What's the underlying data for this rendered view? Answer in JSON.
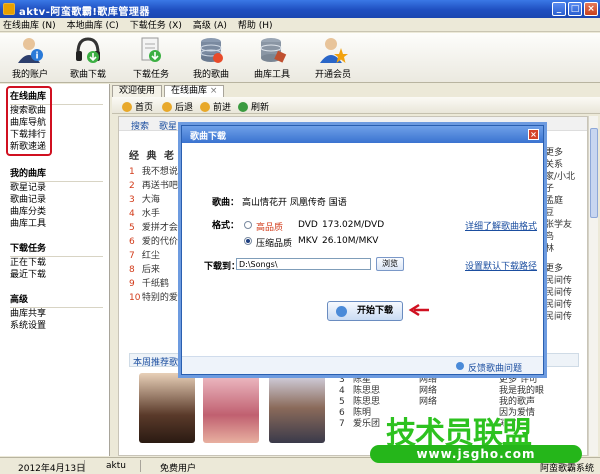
{
  "window": {
    "title": "aktv-阿蛮歌霸!歌库管理器"
  },
  "menu": [
    "在线曲库 (N)",
    "本地曲库 (C)",
    "下载任务 (X)",
    "高级 (A)",
    "帮助 (H)"
  ],
  "toolbar": [
    {
      "label": "我的账户",
      "icon": "user-info-icon"
    },
    {
      "label": "歌曲下载",
      "icon": "headphones-icon"
    },
    {
      "label": "下载任务",
      "icon": "download-task-icon"
    },
    {
      "label": "我的歌曲",
      "icon": "database-icon"
    },
    {
      "label": "曲库工具",
      "icon": "tools-database-icon"
    },
    {
      "label": "开通会员",
      "icon": "member-star-icon"
    }
  ],
  "sidebar": [
    {
      "title": "在线曲库",
      "items": [
        "搜索歌曲",
        "曲库导航",
        "下载排行",
        "新歌速递"
      ]
    },
    {
      "title": "我的曲库",
      "items": [
        "歌星记录",
        "歌曲记录",
        "曲库分类",
        "曲库工具"
      ]
    },
    {
      "title": "下载任务",
      "items": [
        "正在下载",
        "最近下载"
      ]
    },
    {
      "title": "高级",
      "items": [
        "曲库共享",
        "系统设置"
      ]
    }
  ],
  "tabs": [
    "欢迎使用",
    "在线曲库"
  ],
  "nav": [
    "首页",
    "后退",
    "前进",
    "刷新"
  ],
  "content": {
    "strip": [
      "搜索",
      "歌星"
    ],
    "left_header": "经 典 老",
    "left_rows": [
      {
        "n": "1",
        "t": "我不想说"
      },
      {
        "n": "2",
        "t": "再送书吧"
      },
      {
        "n": "3",
        "t": "大海"
      },
      {
        "n": "4",
        "t": "水手"
      },
      {
        "n": "5",
        "t": "爱拼才会"
      },
      {
        "n": "6",
        "t": "爱的代价"
      },
      {
        "n": "7",
        "t": "红尘"
      },
      {
        "n": "8",
        "t": "后来"
      },
      {
        "n": "9",
        "t": "千纸鹤"
      },
      {
        "n": "10",
        "t": "特别的爱"
      }
    ],
    "right_top": [
      "更多",
      "关系",
      "家/小北",
      "子",
      "孟庭",
      "豆",
      "张学友",
      "鸟",
      "林"
    ],
    "right_mid": [
      "更多",
      "民间传",
      "民间传",
      "民间传",
      "民间传"
    ],
    "recommend_label": "本周推荐歌曲",
    "bottom_col1": [
      "3",
      "4",
      "5",
      "6",
      "7"
    ],
    "bottom_col2": [
      "陈星",
      "陈思思",
      "陈思思",
      "陈明",
      "爱乐团"
    ],
    "bottom_col3": [
      "网络",
      "网络",
      "网络"
    ],
    "bottom_right": [
      "更多  许可",
      "我是我的眼",
      "我的歌声",
      "因为爱情",
      "爱情"
    ]
  },
  "dialog": {
    "title": "歌曲下载",
    "song_label": "歌曲：",
    "song_value": "高山情花开 凤凰传奇 国语",
    "format_label": "格式：",
    "options": [
      {
        "label": "高品质",
        "fmt": "DVD",
        "size": "173.02M/DVD",
        "selected": false
      },
      {
        "label": "压缩品质",
        "fmt": "MKV",
        "size": "26.10M/MKV",
        "selected": true
      }
    ],
    "format_link": "详细了解歌曲格式",
    "path_label": "下载到：",
    "path_value": "D:\\Songs\\",
    "browse": "浏览",
    "path_link": "设置默认下载路径",
    "start": "开始下载",
    "feedback": "反馈歌曲问题"
  },
  "status": {
    "date": "2012年4月13日",
    "user": "aktu",
    "role": "免费用户",
    "right": "阿蛮歌霸系统"
  },
  "watermark": {
    "brand": "技术员联盟",
    "url": "www.jsgho.com"
  }
}
